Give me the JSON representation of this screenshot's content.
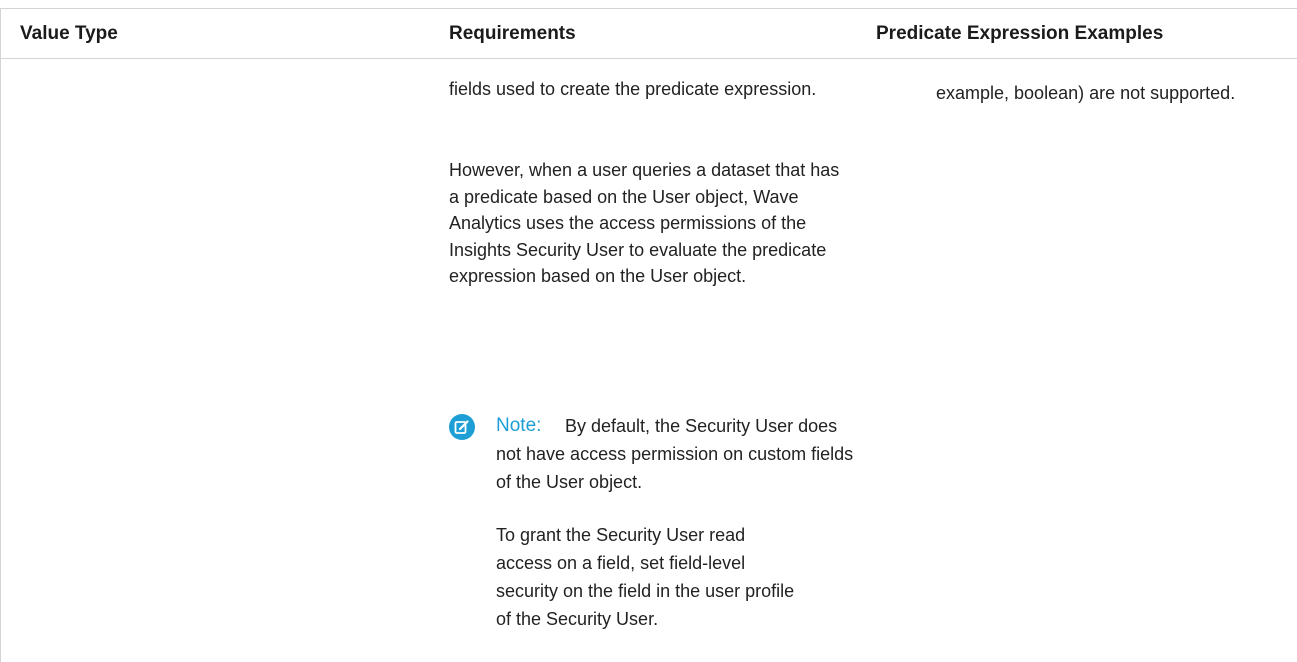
{
  "table": {
    "headers": {
      "value_type": "Value Type",
      "requirements": "Requirements",
      "examples": "Predicate Expression Examples"
    },
    "row": {
      "requirements": {
        "p1": "fields used to create the predicate expression.",
        "p2": "However, when a user queries a dataset that has a predicate based on the User object, Wave Analytics uses the access permissions of the Insights Security User to evaluate the predicate expression based on the User object.",
        "note": {
          "icon": "edit-note-icon",
          "label": "Note:",
          "text": "By default, the Security User does not have access permission on custom fields of the User object.",
          "p2": "To grant the Security User read access on a field, set field-level security on the field in the user profile of the Security User."
        }
      },
      "examples": {
        "p1": "example, boolean) are not supported."
      }
    }
  },
  "colors": {
    "note_accent": "#1d9fd6",
    "rule": "#d4d4d4",
    "text": "#222222"
  }
}
